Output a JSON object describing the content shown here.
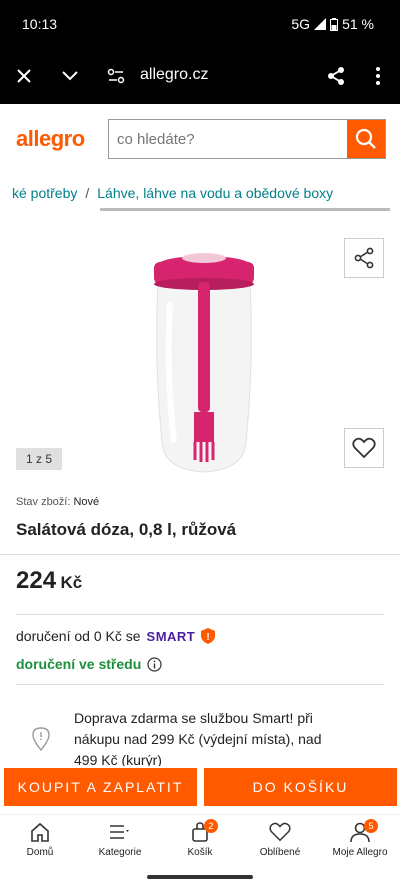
{
  "status": {
    "time": "10:13",
    "network": "5G",
    "battery": "51 %"
  },
  "browser": {
    "url": "allegro.cz"
  },
  "header": {
    "logo": "allegro",
    "search_placeholder": "co hledáte?"
  },
  "breadcrumb": {
    "items": [
      "ké potřeby",
      "Láhve, láhve na vodu a obědové boxy"
    ],
    "separator": "/"
  },
  "gallery": {
    "counter": "1 z 5"
  },
  "product": {
    "condition_label": "Stav zboží:",
    "condition_value": "Nové",
    "title": "Salátová dóza, 0,8 l, růžová",
    "price": "224",
    "currency": "Kč"
  },
  "delivery": {
    "from_text": "doručení od 0 Kč se",
    "smart": "SMART",
    "day_text": "doručení ve středu",
    "info": "Doprava zdarma se službou Smart! při nákupu nad 299 Kč (výdejní místa), nad 499 Kč (kurýr)"
  },
  "actions": {
    "buy_now": "KOUPIT A ZAPLATIT",
    "add_to_cart": "DO KOŠÍKU"
  },
  "nav": [
    {
      "label": "Domů",
      "icon": "home-icon"
    },
    {
      "label": "Kategorie",
      "icon": "menu-icon"
    },
    {
      "label": "Košík",
      "icon": "cart-icon",
      "badge": "2"
    },
    {
      "label": "Oblíbené",
      "icon": "heart-icon"
    },
    {
      "label": "Moje Allegro",
      "icon": "user-icon",
      "badge": "5"
    }
  ],
  "colors": {
    "accent": "#ff5a00",
    "smart": "#4a1fa0",
    "delivery_green": "#1a8f3c",
    "link": "#00808a",
    "product_pink": "#d6246e"
  }
}
